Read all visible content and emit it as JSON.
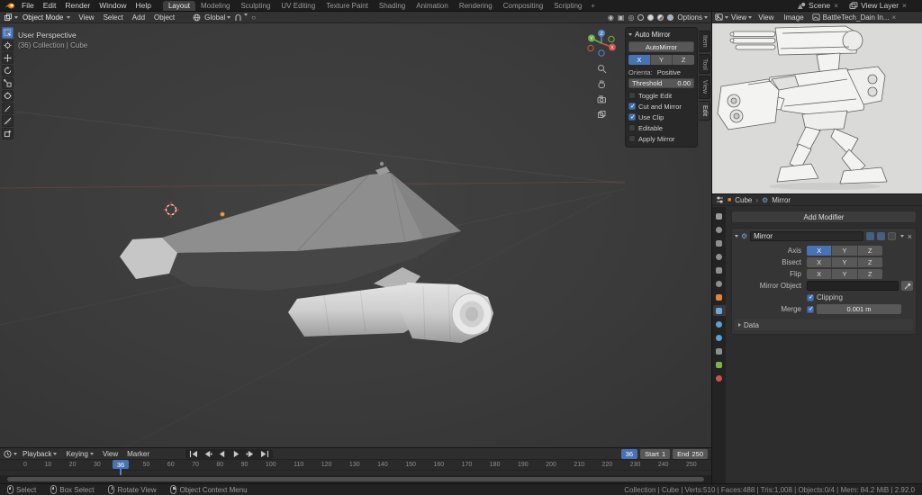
{
  "topbar": {
    "menus": [
      "File",
      "Edit",
      "Render",
      "Window",
      "Help"
    ],
    "workspaces": [
      "Layout",
      "Modeling",
      "Sculpting",
      "UV Editing",
      "Texture Paint",
      "Shading",
      "Animation",
      "Rendering",
      "Compositing",
      "Scripting"
    ],
    "add_workspace": "+",
    "scene_label": "Scene",
    "view_layer_label": "View Layer"
  },
  "viewport": {
    "mode": "Object Mode",
    "menus": [
      "View",
      "Select",
      "Add",
      "Object"
    ],
    "orientation": "Global",
    "options_label": "Options",
    "overlay_title": "User Perspective",
    "overlay_context": "(36) Collection | Cube",
    "sidebar_tabs": [
      "Item",
      "Tool",
      "View",
      "Edit"
    ]
  },
  "auto_mirror": {
    "title": "Auto Mirror",
    "button_label": "AutoMirror",
    "axes": [
      "X",
      "Y",
      "Z"
    ],
    "orientation_label": "Orienta:",
    "orientation_value": "Positive",
    "threshold_label": "Threshold",
    "threshold_value": "0.00",
    "options": [
      {
        "label": "Toggle Edit",
        "checked": false
      },
      {
        "label": "Cut and Mirror",
        "checked": true
      },
      {
        "label": "Use Clip",
        "checked": true
      },
      {
        "label": "Editable",
        "checked": false
      },
      {
        "label": "Apply Mirror",
        "checked": false
      }
    ]
  },
  "image_editor": {
    "mode": "View",
    "menus": [
      "View",
      "Image"
    ],
    "image_name": "BattleTech_Dain In..."
  },
  "properties": {
    "breadcrumb": {
      "object": "Cube",
      "modifier": "Mirror"
    },
    "add_modifier_label": "Add Modifier",
    "modifier_name": "Mirror",
    "axes": [
      "X",
      "Y",
      "Z"
    ],
    "rows": {
      "axis": "Axis",
      "bisect": "Bisect",
      "flip": "Flip",
      "mirror_object": "Mirror Object",
      "clipping": "Clipping",
      "merge": "Merge",
      "merge_value": "0.001 m",
      "data": "Data"
    }
  },
  "timeline": {
    "menus": [
      "Playback",
      "Keying",
      "View",
      "Marker"
    ],
    "current_frame": "36",
    "start_label": "Start",
    "start_value": "1",
    "end_label": "End",
    "end_value": "250",
    "ticks": [
      "0",
      "10",
      "20",
      "30",
      "40",
      "50",
      "60",
      "70",
      "80",
      "90",
      "100",
      "110",
      "120",
      "130",
      "140",
      "150",
      "160",
      "170",
      "180",
      "190",
      "200",
      "210",
      "220",
      "230",
      "240",
      "250"
    ]
  },
  "statusbar": {
    "hints": [
      "Select",
      "Box Select",
      "Rotate View",
      "Object Context Menu"
    ],
    "stats": "Collection | Cube | Verts:510 | Faces:488 | Tris:1,008 | Objects:0/4 | Mem: 84.2 MiB | 2.92.0"
  },
  "colors": {
    "accent": "#4772b3",
    "object_orange": "#e0833c"
  }
}
